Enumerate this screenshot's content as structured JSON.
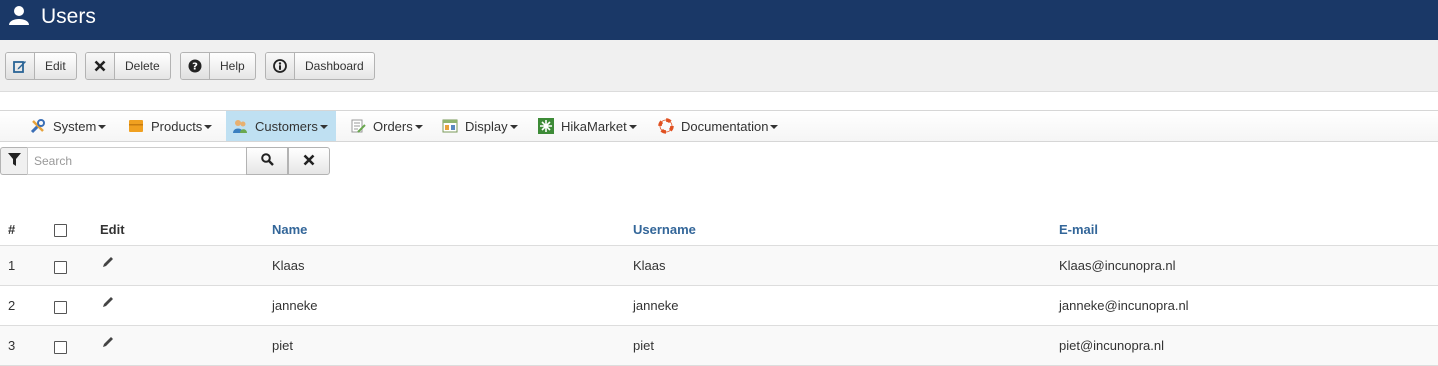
{
  "header": {
    "title": "Users",
    "icon": "user-icon"
  },
  "toolbar": {
    "buttons": [
      {
        "label": "Edit",
        "icon": "edit-icon"
      },
      {
        "label": "Delete",
        "icon": "close-icon"
      },
      {
        "label": "Help",
        "icon": "question-icon"
      },
      {
        "label": "Dashboard",
        "icon": "info-icon"
      }
    ]
  },
  "menu": {
    "items": [
      {
        "label": "System",
        "icon": "tools-icon"
      },
      {
        "label": "Products",
        "icon": "products-icon"
      },
      {
        "label": "Customers",
        "icon": "customers-icon",
        "active": true
      },
      {
        "label": "Orders",
        "icon": "orders-icon"
      },
      {
        "label": "Display",
        "icon": "display-icon"
      },
      {
        "label": "HikaMarket",
        "icon": "hikamarket-icon"
      },
      {
        "label": "Documentation",
        "icon": "lifebuoy-icon"
      }
    ]
  },
  "search": {
    "placeholder": "Search",
    "value": ""
  },
  "table": {
    "headers": {
      "num": "#",
      "edit": "Edit",
      "name": "Name",
      "username": "Username",
      "email": "E-mail"
    },
    "rows": [
      {
        "num": "1",
        "name": "Klaas",
        "username": "Klaas",
        "email": "Klaas@incunopra.nl"
      },
      {
        "num": "2",
        "name": "janneke",
        "username": "janneke",
        "email": "janneke@incunopra.nl"
      },
      {
        "num": "3",
        "name": "piet",
        "username": "piet",
        "email": "piet@incunopra.nl"
      }
    ]
  },
  "colors": {
    "header_bg": "#1a3867",
    "link": "#336699",
    "active_menu": "#bfe0f2"
  }
}
